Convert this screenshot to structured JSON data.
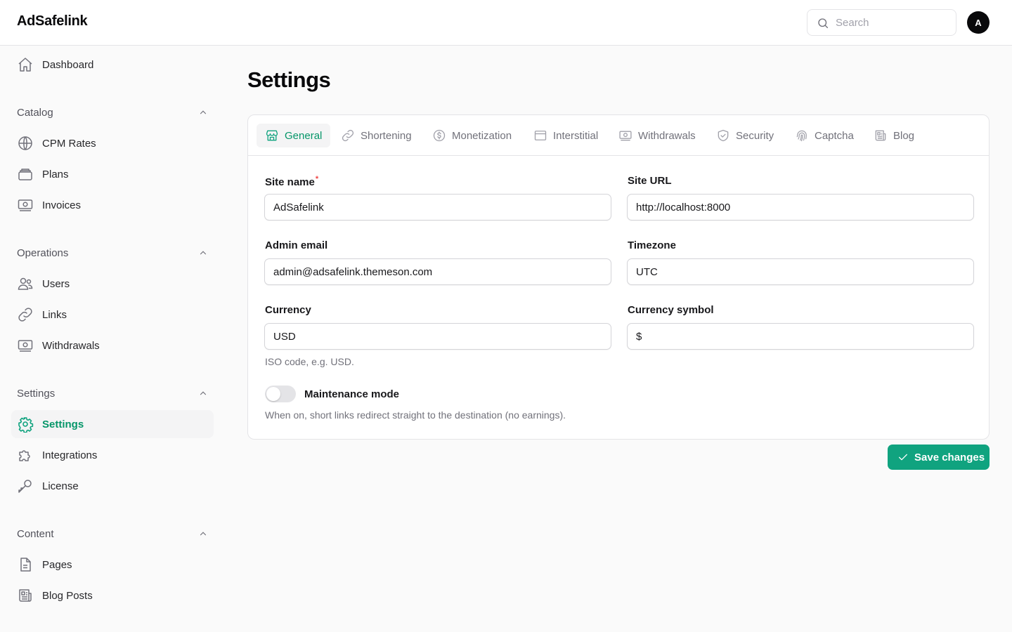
{
  "app": {
    "brand": "AdSafelink"
  },
  "header": {
    "search_placeholder": "Search",
    "avatar_initial": "A"
  },
  "sidebar": {
    "dashboard": "Dashboard",
    "groups": {
      "catalog": {
        "label": "Catalog",
        "items": [
          "CPM Rates",
          "Plans",
          "Invoices"
        ]
      },
      "operations": {
        "label": "Operations",
        "items": [
          "Users",
          "Links",
          "Withdrawals"
        ]
      },
      "settings": {
        "label": "Settings",
        "items": [
          "Settings",
          "Integrations",
          "License"
        ]
      },
      "content": {
        "label": "Content",
        "items": [
          "Pages",
          "Blog Posts"
        ]
      }
    },
    "active_item": "Settings"
  },
  "page": {
    "title": "Settings"
  },
  "tabs": [
    "General",
    "Shortening",
    "Monetization",
    "Interstitial",
    "Withdrawals",
    "Security",
    "Captcha",
    "Blog"
  ],
  "active_tab": "General",
  "form": {
    "site_name": {
      "label": "Site name",
      "required_mark": "*",
      "value": "AdSafelink"
    },
    "site_url": {
      "label": "Site URL",
      "value": "http://localhost:8000"
    },
    "admin_email": {
      "label": "Admin email",
      "value": "admin@adsafelink.themeson.com"
    },
    "timezone": {
      "label": "Timezone",
      "value": "UTC"
    },
    "currency": {
      "label": "Currency",
      "value": "USD",
      "help": "ISO code, e.g. USD."
    },
    "currency_symbol": {
      "label": "Currency symbol",
      "value": "$"
    },
    "maintenance": {
      "label": "Maintenance mode",
      "enabled": false,
      "help": "When on, short links redirect straight to the destination (no earnings)."
    }
  },
  "actions": {
    "save_label": "Save changes"
  },
  "colors": {
    "accent": "#10a37f",
    "accent_text": "#059669",
    "required": "#ef4444"
  }
}
